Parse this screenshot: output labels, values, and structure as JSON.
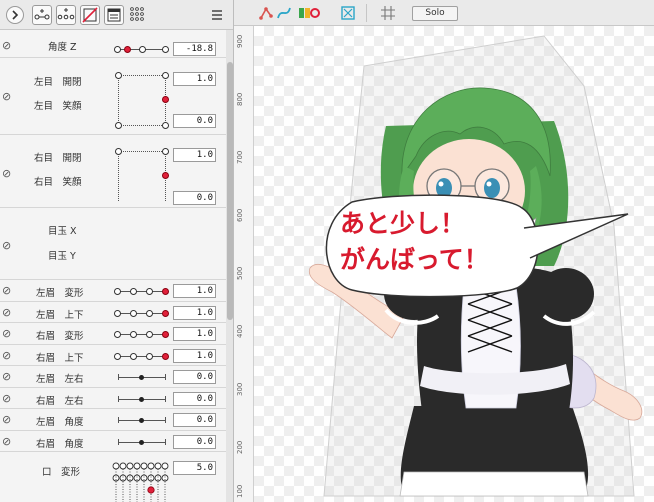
{
  "view_toolbar": {
    "solo_label": "Solo"
  },
  "ruler": {
    "labels": [
      "900",
      "800",
      "700",
      "600",
      "500",
      "400",
      "300",
      "200",
      "100"
    ]
  },
  "speech": {
    "line1": "あと少し！",
    "line2": "がんばって！"
  },
  "params": {
    "angle_z": {
      "label": "角度 Z",
      "value": "-18.8"
    },
    "left_eye": {
      "open_label": "左目　開閉",
      "smile_label": "左目　笑顔",
      "value_top": "1.0",
      "value_bottom": "0.0"
    },
    "right_eye": {
      "open_label": "右目　開閉",
      "smile_label": "右目　笑顔",
      "value_top": "1.0",
      "value_bottom": "0.0"
    },
    "eyeball": {
      "x_label": "目玉 X",
      "y_label": "目玉 Y"
    },
    "rows": [
      {
        "label": "左眉　変形",
        "value": "1.0"
      },
      {
        "label": "左眉　上下",
        "value": "1.0"
      },
      {
        "label": "右眉　変形",
        "value": "1.0"
      },
      {
        "label": "右眉　上下",
        "value": "1.0"
      },
      {
        "label": "左眉　左右",
        "value": "0.0"
      },
      {
        "label": "右眉　左右",
        "value": "0.0"
      },
      {
        "label": "左眉　角度",
        "value": "0.0"
      },
      {
        "label": "右眉　角度",
        "value": "0.0"
      }
    ],
    "mouth": {
      "label": "口　変形",
      "value": "5.0"
    }
  },
  "colors": {
    "accent_red": "#e0203a",
    "speech_red": "#d81a2e",
    "hair_green": "#5cae5a",
    "dress_black": "#2a2a2a",
    "skin": "#fbe1d3"
  },
  "icons": [
    "expand-arrow-icon",
    "connect-nodes-icon",
    "multi-nodes-icon",
    "delete-link-icon",
    "panel-icon",
    "grid-dots-icon",
    "menu-icon",
    "bone-icon",
    "curve-icon",
    "color-icon",
    "fit-view-icon",
    "grid-icon"
  ]
}
